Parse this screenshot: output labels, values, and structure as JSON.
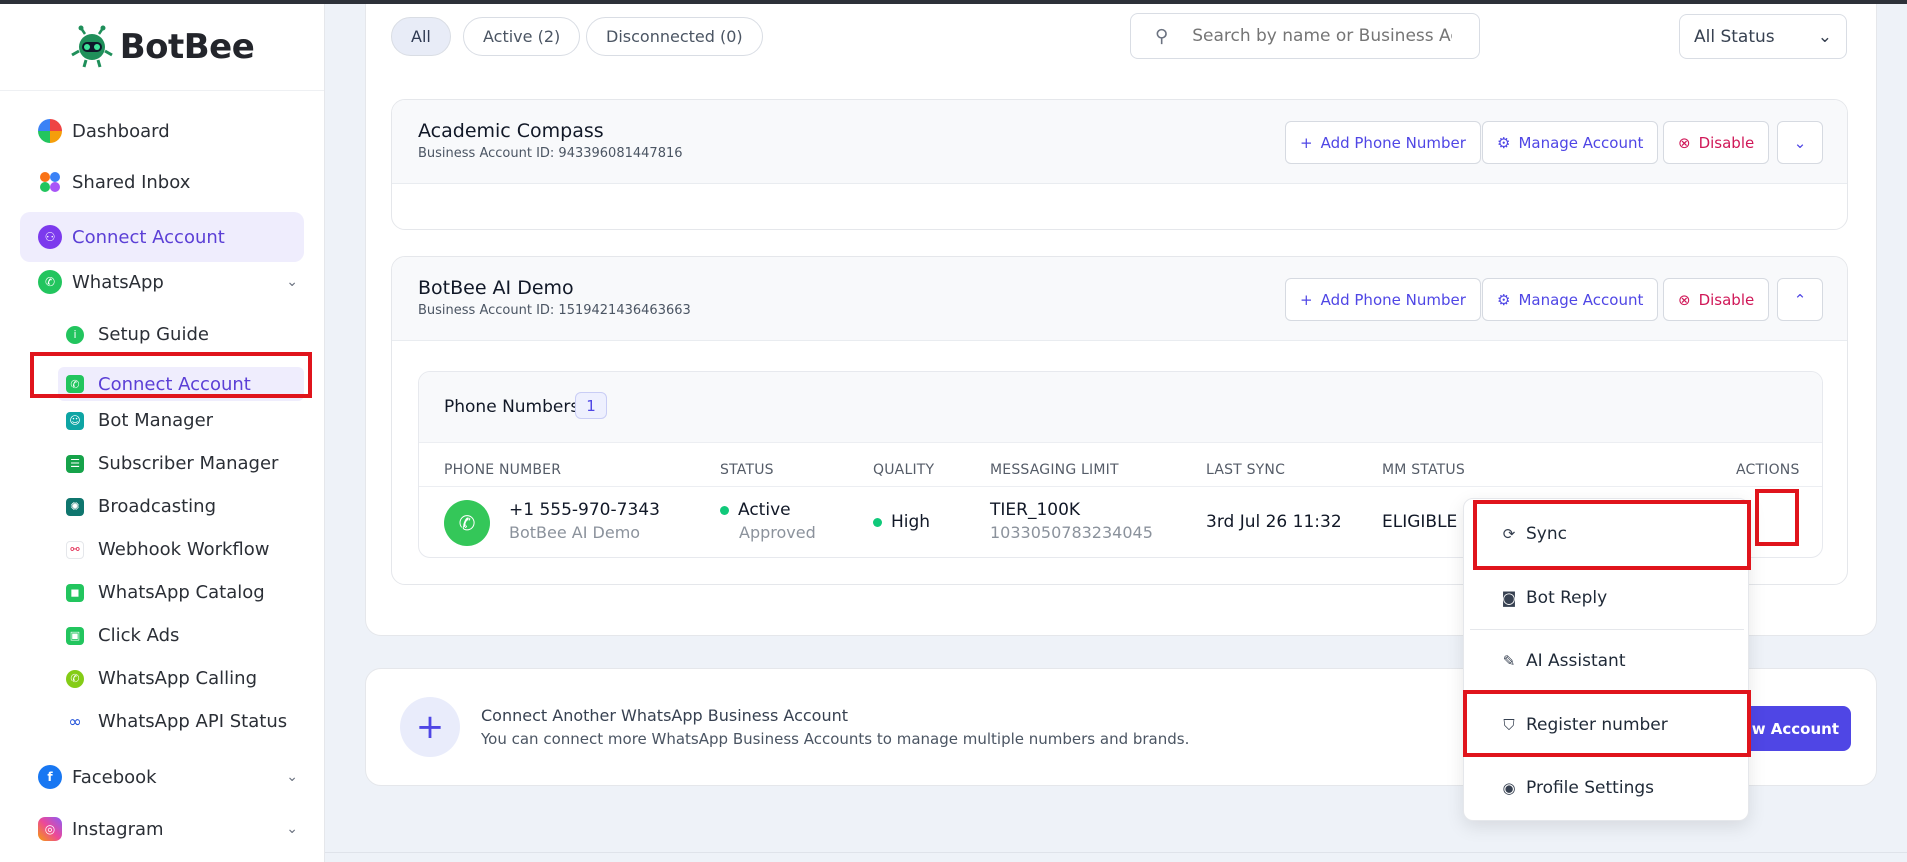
{
  "brand": {
    "name": "BotBee"
  },
  "sidebar": {
    "items": [
      {
        "label": "Dashboard"
      },
      {
        "label": "Shared Inbox"
      },
      {
        "label": "Connect Account"
      },
      {
        "label": "WhatsApp"
      },
      {
        "label": "Facebook"
      },
      {
        "label": "Instagram"
      }
    ],
    "whatsapp_sub": [
      {
        "label": "Setup Guide"
      },
      {
        "label": "Connect Account"
      },
      {
        "label": "Bot Manager"
      },
      {
        "label": "Subscriber Manager"
      },
      {
        "label": "Broadcasting"
      },
      {
        "label": "Webhook Workflow"
      },
      {
        "label": "WhatsApp Catalog"
      },
      {
        "label": "Click Ads"
      },
      {
        "label": "WhatsApp Calling"
      },
      {
        "label": "WhatsApp API Status"
      }
    ]
  },
  "filters": {
    "tabs": [
      {
        "label": "All"
      },
      {
        "label": "Active (2)"
      },
      {
        "label": "Disconnected (0)"
      }
    ],
    "search_placeholder": "Search by name or Business Acc",
    "status_select": "All Status"
  },
  "accounts": [
    {
      "name": "Academic Compass",
      "id_text": "Business Account ID: 943396081447816",
      "add_phone": "Add Phone Number",
      "manage": "Manage Account",
      "disable": "Disable"
    },
    {
      "name": "BotBee AI Demo",
      "id_text": "Business Account ID: 1519421436463663",
      "add_phone": "Add Phone Number",
      "manage": "Manage Account",
      "disable": "Disable"
    }
  ],
  "phone_table": {
    "title": "Phone Numbers",
    "count": "1",
    "columns": [
      "PHONE NUMBER",
      "STATUS",
      "QUALITY",
      "MESSAGING LIMIT",
      "LAST SYNC",
      "MM STATUS",
      "ACTIONS"
    ],
    "row": {
      "number": "+1 555-970-7343",
      "name": "BotBee AI Demo",
      "status": "Active",
      "status_sub": "Approved",
      "quality": "High",
      "limit": "TIER_100K",
      "limit_sub": "1033050783234045",
      "last_sync": "3rd Jul 26 11:32",
      "mm_status": "ELIGIBLE"
    }
  },
  "connect_more": {
    "title": "Connect Another WhatsApp Business Account",
    "subtitle": "You can connect more WhatsApp Business Accounts to manage multiple numbers and brands.",
    "button": "w Account"
  },
  "menu": {
    "items": [
      {
        "label": "Sync",
        "icon": "sync-icon"
      },
      {
        "label": "Bot Reply",
        "icon": "robot-icon"
      },
      {
        "label": "AI Assistant",
        "icon": "magic-wand-icon"
      },
      {
        "label": "Register number",
        "icon": "shield-icon"
      },
      {
        "label": "Profile Settings",
        "icon": "user-circle-icon"
      }
    ]
  },
  "colors": {
    "accent": "#4f46e5",
    "active_nav_bg": "#efedfd",
    "danger": "#d01858",
    "success": "#10c97a",
    "highlight_box": "#e0141c"
  }
}
